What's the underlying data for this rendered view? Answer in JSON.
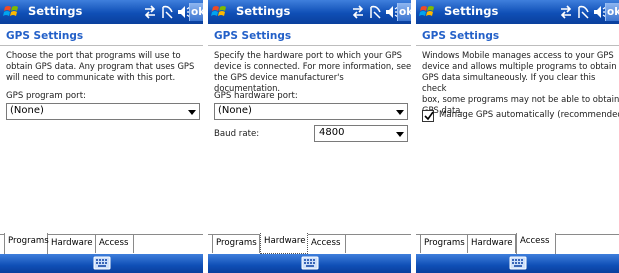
{
  "window": {
    "title": "Settings",
    "ok_label": "ok",
    "status_icons": [
      "connectivity-icon",
      "signal-off-icon",
      "speaker-icon"
    ]
  },
  "heading": "GPS Settings",
  "panels": [
    {
      "description_lines": [
        "Choose the port that programs will use to",
        "obtain GPS data. Any program that uses GPS",
        "will need to communicate with this port."
      ],
      "port_label": "GPS program port:",
      "port_value": "(None)",
      "active_tab": "Programs"
    },
    {
      "description_lines": [
        "Specify the hardware port to which your GPS",
        "device is connected. For more information, see",
        "the GPS device manufacturer's documentation."
      ],
      "port_label": "GPS hardware port:",
      "port_value": "(None)",
      "baud_label": "Baud rate:",
      "baud_value": "4800",
      "active_tab": "Hardware"
    },
    {
      "description_lines": [
        "Windows Mobile manages access to your GPS",
        "device and allows multiple programs to obtain",
        "GPS data simultaneously. If you clear this check",
        "box, some programs may not be able to obtain",
        "GPS data."
      ],
      "checkbox_label": "Manage GPS automatically (recommended)",
      "checkbox_checked": true,
      "active_tab": "Access"
    }
  ],
  "tabs": [
    "Programs",
    "Hardware",
    "Access"
  ],
  "colors": {
    "titlebar": "#0f4fb6",
    "heading": "#2360c8"
  }
}
